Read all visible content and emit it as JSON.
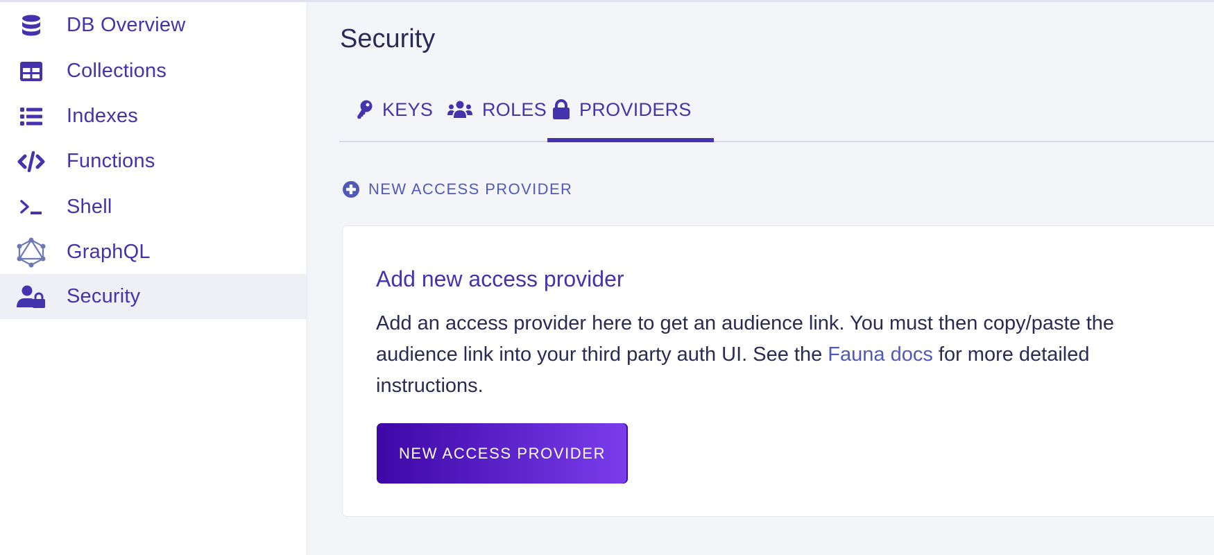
{
  "sidebar": {
    "items": [
      {
        "label": "DB Overview",
        "icon": "database-icon"
      },
      {
        "label": "Collections",
        "icon": "table-icon"
      },
      {
        "label": "Indexes",
        "icon": "list-icon"
      },
      {
        "label": "Functions",
        "icon": "code-icon"
      },
      {
        "label": "Shell",
        "icon": "terminal-icon"
      },
      {
        "label": "GraphQL",
        "icon": "graphql-icon"
      },
      {
        "label": "Security",
        "icon": "user-lock-icon",
        "active": true
      }
    ]
  },
  "header": {
    "title": "Security"
  },
  "tabs": [
    {
      "label": "KEYS",
      "icon": "key-icon"
    },
    {
      "label": "ROLES",
      "icon": "users-icon"
    },
    {
      "label": "PROVIDERS",
      "icon": "lock-icon",
      "active": true
    }
  ],
  "new_link": {
    "label": "NEW ACCESS PROVIDER",
    "icon": "plus-circle-icon"
  },
  "card": {
    "heading": "Add new access provider",
    "body_before": "Add an access provider here to get an audience link. You must then copy/paste the audience link into your third party auth UI. See the ",
    "link_text": "Fauna docs",
    "body_after": " for more detailed instructions.",
    "button_label": "NEW ACCESS PROVIDER"
  },
  "colors": {
    "accent": "#4433ad",
    "link": "#5059b8",
    "text": "#2b2a55",
    "background": "#f4f5f9",
    "button_gradient_start": "#3e07a6",
    "button_gradient_end": "#7c3ded"
  }
}
